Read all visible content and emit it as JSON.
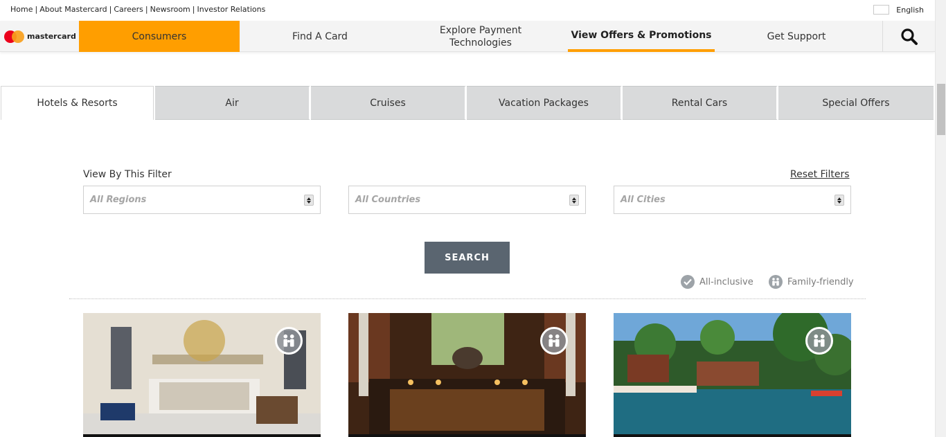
{
  "utility": {
    "links": [
      "Home",
      "About Mastercard",
      "Careers",
      "Newsroom",
      "Investor Relations"
    ],
    "language": "English"
  },
  "nav": {
    "logo_text": "mastercard",
    "items": [
      "Consumers",
      "Find A Card",
      "Explore Payment Technologies",
      "View Offers & Promotions",
      "Get Support"
    ],
    "active_section": "Consumers",
    "current_page": "View Offers & Promotions",
    "accent_color": "#ff9e00"
  },
  "tabs": {
    "items": [
      "Hotels & Resorts",
      "Air",
      "Cruises",
      "Vacation Packages",
      "Rental Cars",
      "Special Offers"
    ],
    "active": "Hotels & Resorts"
  },
  "filters": {
    "label": "View By This Filter",
    "reset_label": "Reset Filters",
    "region": "All Regions",
    "country": "All Countries",
    "city": "All Cities",
    "search_label": "SEARCH"
  },
  "legend": {
    "all_inclusive": "All-inclusive",
    "family_friendly": "Family-friendly"
  },
  "cards": [
    {
      "badge": "family-friendly-icon"
    },
    {
      "badge": "family-friendly-icon"
    },
    {
      "badge": "family-friendly-icon"
    }
  ]
}
